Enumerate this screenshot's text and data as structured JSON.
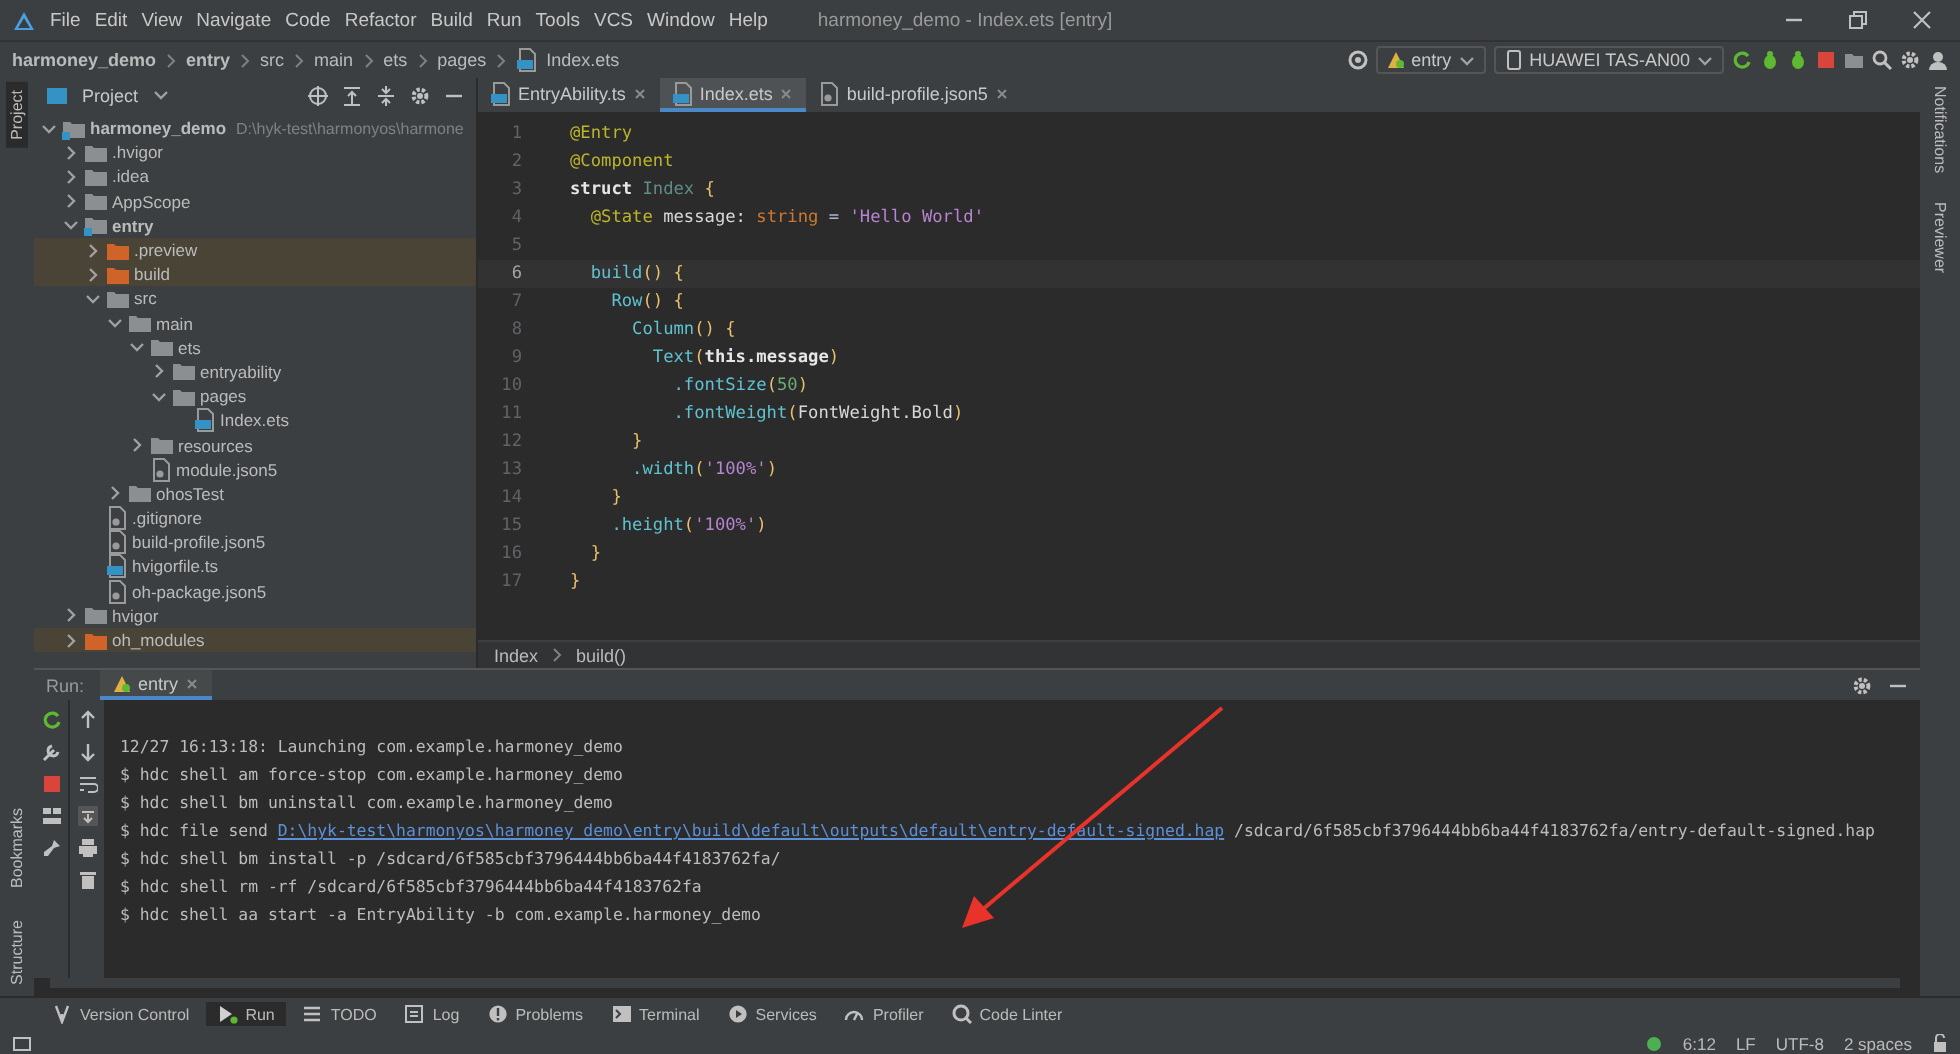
{
  "window": {
    "title": "harmoney_demo - Index.ets [entry]"
  },
  "menu": [
    "File",
    "Edit",
    "View",
    "Navigate",
    "Code",
    "Refactor",
    "Build",
    "Run",
    "Tools",
    "VCS",
    "Window",
    "Help"
  ],
  "breadcrumbs": [
    {
      "label": "harmoney_demo",
      "bold": true
    },
    {
      "label": "entry",
      "bold": true
    },
    {
      "label": "src",
      "bold": false
    },
    {
      "label": "main",
      "bold": false
    },
    {
      "label": "ets",
      "bold": false
    },
    {
      "label": "pages",
      "bold": false
    },
    {
      "label": "Index.ets",
      "bold": false
    }
  ],
  "run_config": "entry",
  "device": "HUAWEI TAS-AN00",
  "left_strip": {
    "top": [
      {
        "label": "Project",
        "selected": true
      }
    ],
    "bottom": [
      {
        "label": "Bookmarks",
        "selected": false
      },
      {
        "label": "Structure",
        "selected": false
      }
    ]
  },
  "right_strip": [
    "Notifications",
    "Previewer"
  ],
  "project": {
    "title": "Project",
    "tree": [
      {
        "label": "harmoney_demo",
        "kind": "module",
        "expanded": true,
        "excluded": false,
        "path": "D:\\hyk-test\\harmonyos\\harmone",
        "children": [
          {
            "label": ".hvigor",
            "kind": "folder",
            "expanded": false,
            "excluded": false
          },
          {
            "label": ".idea",
            "kind": "folder",
            "expanded": false,
            "excluded": false
          },
          {
            "label": "AppScope",
            "kind": "folder",
            "expanded": false,
            "excluded": false
          },
          {
            "label": "entry",
            "kind": "module",
            "expanded": true,
            "excluded": false,
            "children": [
              {
                "label": ".preview",
                "kind": "folder",
                "expanded": false,
                "excluded": true
              },
              {
                "label": "build",
                "kind": "folder",
                "expanded": false,
                "excluded": true
              },
              {
                "label": "src",
                "kind": "folder",
                "expanded": true,
                "excluded": false,
                "children": [
                  {
                    "label": "main",
                    "kind": "folder",
                    "expanded": true,
                    "excluded": false,
                    "children": [
                      {
                        "label": "ets",
                        "kind": "folder",
                        "expanded": true,
                        "excluded": false,
                        "children": [
                          {
                            "label": "entryability",
                            "kind": "folder",
                            "expanded": false,
                            "excluded": false
                          },
                          {
                            "label": "pages",
                            "kind": "folder",
                            "expanded": true,
                            "excluded": false,
                            "children": [
                              {
                                "label": "Index.ets",
                                "kind": "code-file"
                              }
                            ]
                          }
                        ]
                      },
                      {
                        "label": "resources",
                        "kind": "folder",
                        "expanded": false,
                        "excluded": false
                      },
                      {
                        "label": "module.json5",
                        "kind": "file"
                      }
                    ]
                  },
                  {
                    "label": "ohosTest",
                    "kind": "folder",
                    "expanded": false,
                    "excluded": false
                  }
                ]
              },
              {
                "label": ".gitignore",
                "kind": "file"
              },
              {
                "label": "build-profile.json5",
                "kind": "file"
              },
              {
                "label": "hvigorfile.ts",
                "kind": "code-file"
              },
              {
                "label": "oh-package.json5",
                "kind": "file"
              }
            ]
          },
          {
            "label": "hvigor",
            "kind": "folder",
            "expanded": false,
            "excluded": false
          },
          {
            "label": "oh_modules",
            "kind": "folder",
            "expanded": false,
            "excluded": true
          }
        ]
      }
    ]
  },
  "editor": {
    "tabs": [
      {
        "label": "EntryAbility.ts",
        "kind": "code-file",
        "selected": false
      },
      {
        "label": "Index.ets",
        "kind": "code-file",
        "selected": true
      },
      {
        "label": "build-profile.json5",
        "kind": "file",
        "selected": false
      }
    ],
    "lines": [
      {
        "number": "1",
        "current": false,
        "tokens": [
          {
            "text": "@Entry",
            "kind": "decorator"
          }
        ]
      },
      {
        "number": "2",
        "current": false,
        "tokens": [
          {
            "text": "@Component",
            "kind": "decorator"
          }
        ]
      },
      {
        "number": "3",
        "current": false,
        "tokens": [
          {
            "text": "struct",
            "kind": "keyword"
          },
          {
            "text": " Index ",
            "kind": "type"
          },
          {
            "text": "{",
            "kind": "brace"
          }
        ]
      },
      {
        "number": "4",
        "current": false,
        "tokens": [
          {
            "text": "  @State",
            "kind": "decorator"
          },
          {
            "text": " message: ",
            "kind": "field"
          },
          {
            "text": "string",
            "kind": "typeword"
          },
          {
            "text": " = ",
            "kind": "plain"
          },
          {
            "text": "'Hello World'",
            "kind": "string"
          }
        ]
      },
      {
        "number": "5",
        "current": false
      },
      {
        "number": "6",
        "current": true,
        "tokens": [
          {
            "text": "  build",
            "kind": "func"
          },
          {
            "text": "() ",
            "kind": "brace"
          },
          {
            "text": "{",
            "kind": "brace"
          }
        ]
      },
      {
        "number": "7",
        "current": false,
        "tokens": [
          {
            "text": "    Row",
            "kind": "func"
          },
          {
            "text": "() {",
            "kind": "brace"
          }
        ]
      },
      {
        "number": "8",
        "current": false,
        "tokens": [
          {
            "text": "      Column",
            "kind": "func"
          },
          {
            "text": "() {",
            "kind": "brace"
          }
        ]
      },
      {
        "number": "9",
        "current": false,
        "tokens": [
          {
            "text": "        Text",
            "kind": "func"
          },
          {
            "text": "(",
            "kind": "brace"
          },
          {
            "text": "this.message",
            "kind": "keyword"
          },
          {
            "text": ")",
            "kind": "brace"
          }
        ]
      },
      {
        "number": "10",
        "current": false,
        "tokens": [
          {
            "text": "          .fontSize",
            "kind": "func"
          },
          {
            "text": "(",
            "kind": "brace"
          },
          {
            "text": "50",
            "kind": "number"
          },
          {
            "text": ")",
            "kind": "brace"
          }
        ]
      },
      {
        "number": "11",
        "current": false,
        "tokens": [
          {
            "text": "          .fontWeight",
            "kind": "func"
          },
          {
            "text": "(",
            "kind": "brace"
          },
          {
            "text": "FontWeight.Bold",
            "kind": "field"
          },
          {
            "text": ")",
            "kind": "brace"
          }
        ]
      },
      {
        "number": "12",
        "current": false,
        "tokens": [
          {
            "text": "      }",
            "kind": "brace"
          }
        ]
      },
      {
        "number": "13",
        "current": false,
        "tokens": [
          {
            "text": "      .width",
            "kind": "func"
          },
          {
            "text": "(",
            "kind": "brace"
          },
          {
            "text": "'100%'",
            "kind": "string"
          },
          {
            "text": ")",
            "kind": "brace"
          }
        ]
      },
      {
        "number": "14",
        "current": false,
        "tokens": [
          {
            "text": "    }",
            "kind": "brace"
          }
        ]
      },
      {
        "number": "15",
        "current": false,
        "tokens": [
          {
            "text": "    .height",
            "kind": "func"
          },
          {
            "text": "(",
            "kind": "brace"
          },
          {
            "text": "'100%'",
            "kind": "string"
          },
          {
            "text": ")",
            "kind": "brace"
          }
        ]
      },
      {
        "number": "16",
        "current": false,
        "tokens": [
          {
            "text": "  }",
            "kind": "brace"
          }
        ]
      },
      {
        "number": "17",
        "current": false,
        "tokens": [
          {
            "text": "}",
            "kind": "brace"
          }
        ]
      }
    ],
    "path": [
      "Index",
      "build()"
    ]
  },
  "run": {
    "label": "Run:",
    "tabs": [
      {
        "label": "entry",
        "selected": true
      }
    ],
    "console": [
      {
        "text": "12/27 16:13:18: Launching com.example.harmoney_demo"
      },
      {
        "text": "$ hdc shell am force-stop com.example.harmoney_demo"
      },
      {
        "text": "$ hdc shell bm uninstall com.example.harmoney_demo"
      },
      {
        "text": "$ hdc file send ",
        "link": "D:\\hyk-test\\harmonyos\\harmoney_demo\\entry\\build\\default\\outputs\\default\\entry-default-signed.hap",
        "after": " /sdcard/6f585cbf3796444bb6ba44f4183762fa/entry-default-signed.hap"
      },
      {
        "text": "$ hdc shell bm install -p /sdcard/6f585cbf3796444bb6ba44f4183762fa/"
      },
      {
        "text": "$ hdc shell rm -rf /sdcard/6f585cbf3796444bb6ba44f4183762fa"
      },
      {
        "text": "$ hdc shell aa start -a EntryAbility -b com.example.harmoney_demo"
      }
    ]
  },
  "tool_buttons": [
    {
      "label": "Version Control",
      "selected": false
    },
    {
      "label": "Run",
      "selected": true
    },
    {
      "label": "TODO",
      "selected": false
    },
    {
      "label": "Log",
      "selected": false
    },
    {
      "label": "Problems",
      "selected": false
    },
    {
      "label": "Terminal",
      "selected": false
    },
    {
      "label": "Services",
      "selected": false
    },
    {
      "label": "Profiler",
      "selected": false
    },
    {
      "label": "Code Linter",
      "selected": false
    }
  ],
  "status_bar": [
    "6:12",
    "LF",
    "UTF-8",
    "2 spaces"
  ]
}
